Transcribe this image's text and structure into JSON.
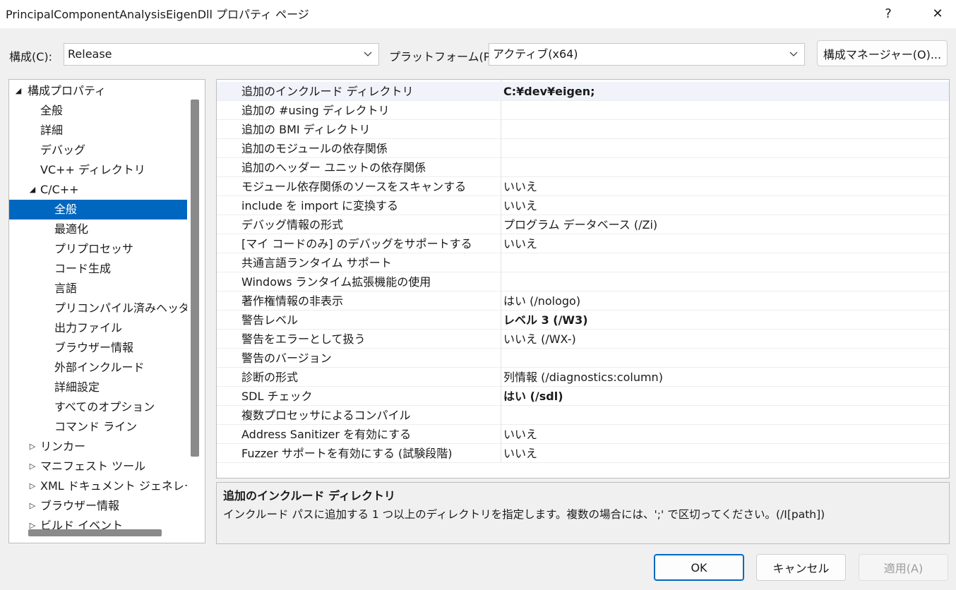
{
  "window": {
    "title": "PrincipalComponentAnalysisEigenDll プロパティ ページ",
    "help_label": "?",
    "close_label": "✕"
  },
  "config": {
    "label": "構成(C):",
    "value": "Release",
    "platform_label": "プラットフォーム(P):",
    "platform_value": "アクティブ(x64)",
    "manager_button": "構成マネージャー(O)..."
  },
  "tree": {
    "items": [
      {
        "label": "構成プロパティ",
        "arrow": "◢"
      },
      {
        "label": "全般"
      },
      {
        "label": "詳細"
      },
      {
        "label": "デバッグ"
      },
      {
        "label": "VC++ ディレクトリ"
      },
      {
        "label": "C/C++",
        "arrow": "◢"
      },
      {
        "label": "全般",
        "selected": true
      },
      {
        "label": "最適化"
      },
      {
        "label": "プリプロセッサ"
      },
      {
        "label": "コード生成"
      },
      {
        "label": "言語"
      },
      {
        "label": "プリコンパイル済みヘッダー"
      },
      {
        "label": "出力ファイル"
      },
      {
        "label": "ブラウザー情報"
      },
      {
        "label": "外部インクルード"
      },
      {
        "label": "詳細設定"
      },
      {
        "label": "すべてのオプション"
      },
      {
        "label": "コマンド ライン"
      },
      {
        "label": "リンカー",
        "arrow": "▷"
      },
      {
        "label": "マニフェスト ツール",
        "arrow": "▷"
      },
      {
        "label": "XML ドキュメント ジェネレーター",
        "arrow": "▷"
      },
      {
        "label": "ブラウザー情報",
        "arrow": "▷"
      },
      {
        "label": "ビルド イベント",
        "arrow": "▷"
      }
    ]
  },
  "properties": [
    {
      "name": "追加のインクルード ディレクトリ",
      "value": "C:¥dev¥eigen;",
      "bold": true
    },
    {
      "name": "追加の #using ディレクトリ",
      "value": ""
    },
    {
      "name": "追加の BMI ディレクトリ",
      "value": ""
    },
    {
      "name": "追加のモジュールの依存関係",
      "value": ""
    },
    {
      "name": "追加のヘッダー ユニットの依存関係",
      "value": ""
    },
    {
      "name": "モジュール依存関係のソースをスキャンする",
      "value": "いいえ"
    },
    {
      "name": "include を import に変換する",
      "value": "いいえ"
    },
    {
      "name": "デバッグ情報の形式",
      "value": "プログラム データベース (/Zi)"
    },
    {
      "name": "[マイ コードのみ] のデバッグをサポートする",
      "value": "いいえ"
    },
    {
      "name": "共通言語ランタイム サポート",
      "value": ""
    },
    {
      "name": "Windows ランタイム拡張機能の使用",
      "value": ""
    },
    {
      "name": "著作権情報の非表示",
      "value": "はい (/nologo)"
    },
    {
      "name": "警告レベル",
      "value": "レベル 3 (/W3)",
      "bold": true
    },
    {
      "name": "警告をエラーとして扱う",
      "value": "いいえ (/WX-)"
    },
    {
      "name": "警告のバージョン",
      "value": ""
    },
    {
      "name": "診断の形式",
      "value": "列情報 (/diagnostics:column)"
    },
    {
      "name": "SDL チェック",
      "value": "はい (/sdl)",
      "bold": true
    },
    {
      "name": "複数プロセッサによるコンパイル",
      "value": ""
    },
    {
      "name": "Address Sanitizer を有効にする",
      "value": "いいえ"
    },
    {
      "name": "Fuzzer サポートを有効にする (試験段階)",
      "value": "いいえ"
    }
  ],
  "description": {
    "title": "追加のインクルード ディレクトリ",
    "text": "インクルード パスに追加する 1 つ以上のディレクトリを指定します。複数の場合には、';' で区切ってください。(/I[path])"
  },
  "buttons": {
    "ok": "OK",
    "cancel": "キャンセル",
    "apply": "適用(A)"
  },
  "colors": {
    "selection": "#0067c0",
    "active_row": "#f0f3f9"
  }
}
